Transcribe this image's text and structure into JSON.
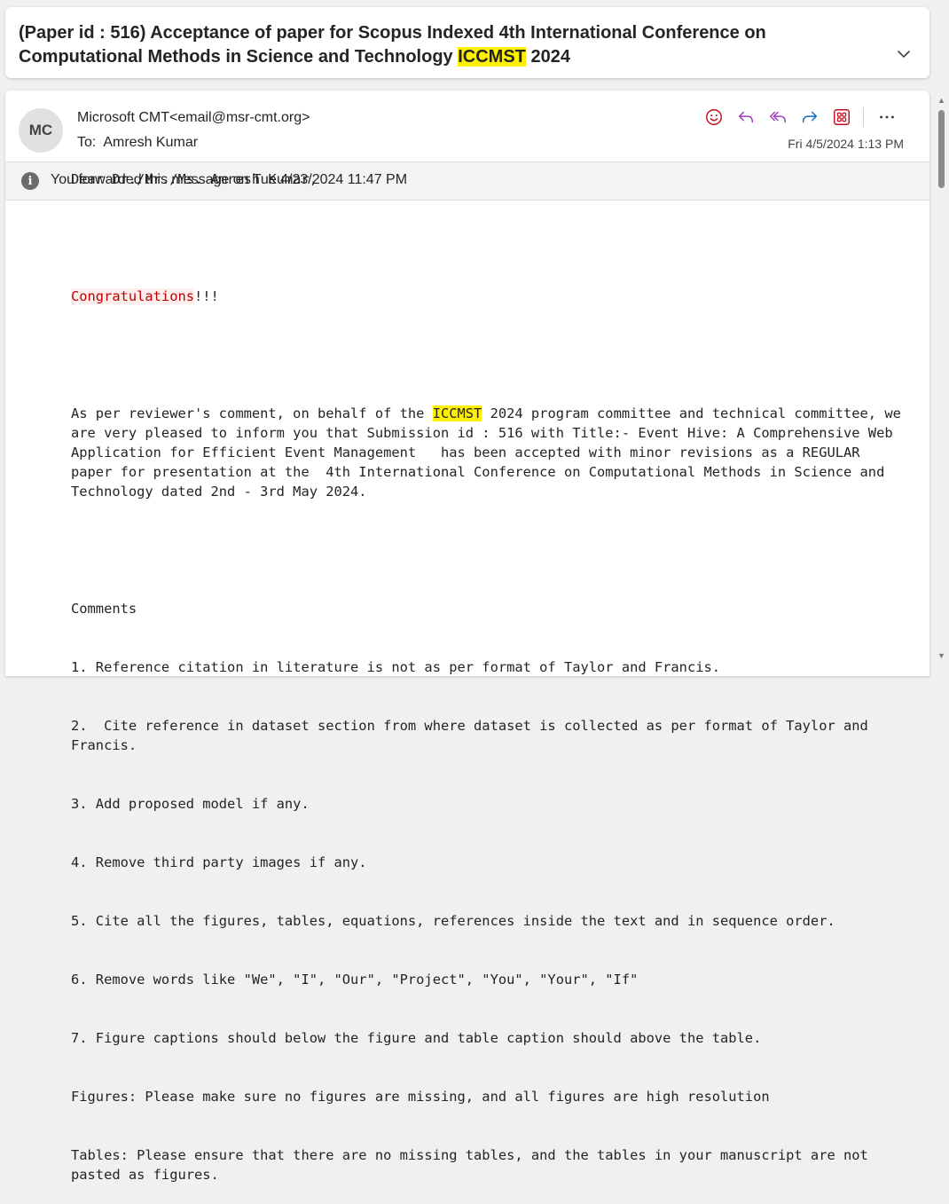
{
  "subject": {
    "before": "(Paper id : 516) Acceptance of paper for Scopus Indexed 4th International Conference on Computational Methods in Science and Technology ",
    "highlight": "ICCMST",
    "after": " 2024"
  },
  "message": {
    "avatar_initials": "MC",
    "sender_name": "Microsoft CMT",
    "sender_email": "<email@msr-cmt.org>",
    "to_label": "To:",
    "to_name": "Amresh Kumar",
    "date": "Fri 4/5/2024 1:13 PM",
    "actions": [
      "emoji-icon",
      "reply-icon",
      "reply-all-icon",
      "forward-icon",
      "apps-icon",
      "more-icon"
    ]
  },
  "info_bar": {
    "icon": "info-icon",
    "text": "You forwarded this message on Tue 4/23/2024 11:47 PM"
  },
  "body": {
    "greeting": "Dear Dr./Mr./Ms. Amresh Kumar,",
    "congrats": "Congratulations",
    "congrats_suffix": "!!!",
    "para_before": "As per reviewer's comment, on behalf of the ",
    "para_highlight": "ICCMST",
    "para_after": " 2024 program committee and technical committee, we are very pleased to inform you that Submission id : 516 with Title:- Event Hive: A Comprehensive Web Application for Efficient Event Management   has been accepted with minor revisions as a REGULAR paper for presentation at the  4th International Conference on Computational Methods in Science and Technology dated 2nd - 3rd May 2024.",
    "comments_heading": "Comments",
    "comments": [
      "1. Reference citation in literature is not as per format of Taylor and Francis.",
      "2.  Cite reference in dataset section from where dataset is collected as per format of Taylor and Francis.",
      "3. Add proposed model if any.",
      "4. Remove third party images if any.",
      "5. Cite all the figures, tables, equations, references inside the text and in sequence order.",
      "6. Remove words like \"We\", \"I\", \"Our\", \"Project\", \"You\", \"Your\", \"If\"",
      "7. Figure captions should below the figure and table caption should above the table.",
      "Figures: Please make sure no figures are missing, and all figures are high resolution",
      "Tables: Please ensure that there are no missing tables, and the tables in your manuscript are not pasted as figures."
    ]
  },
  "colors": {
    "highlight": "#ffef00",
    "accent_icons": "#0f6cbd",
    "emoji_icon": "#c50f1f",
    "congrats_text": "#c00000"
  }
}
